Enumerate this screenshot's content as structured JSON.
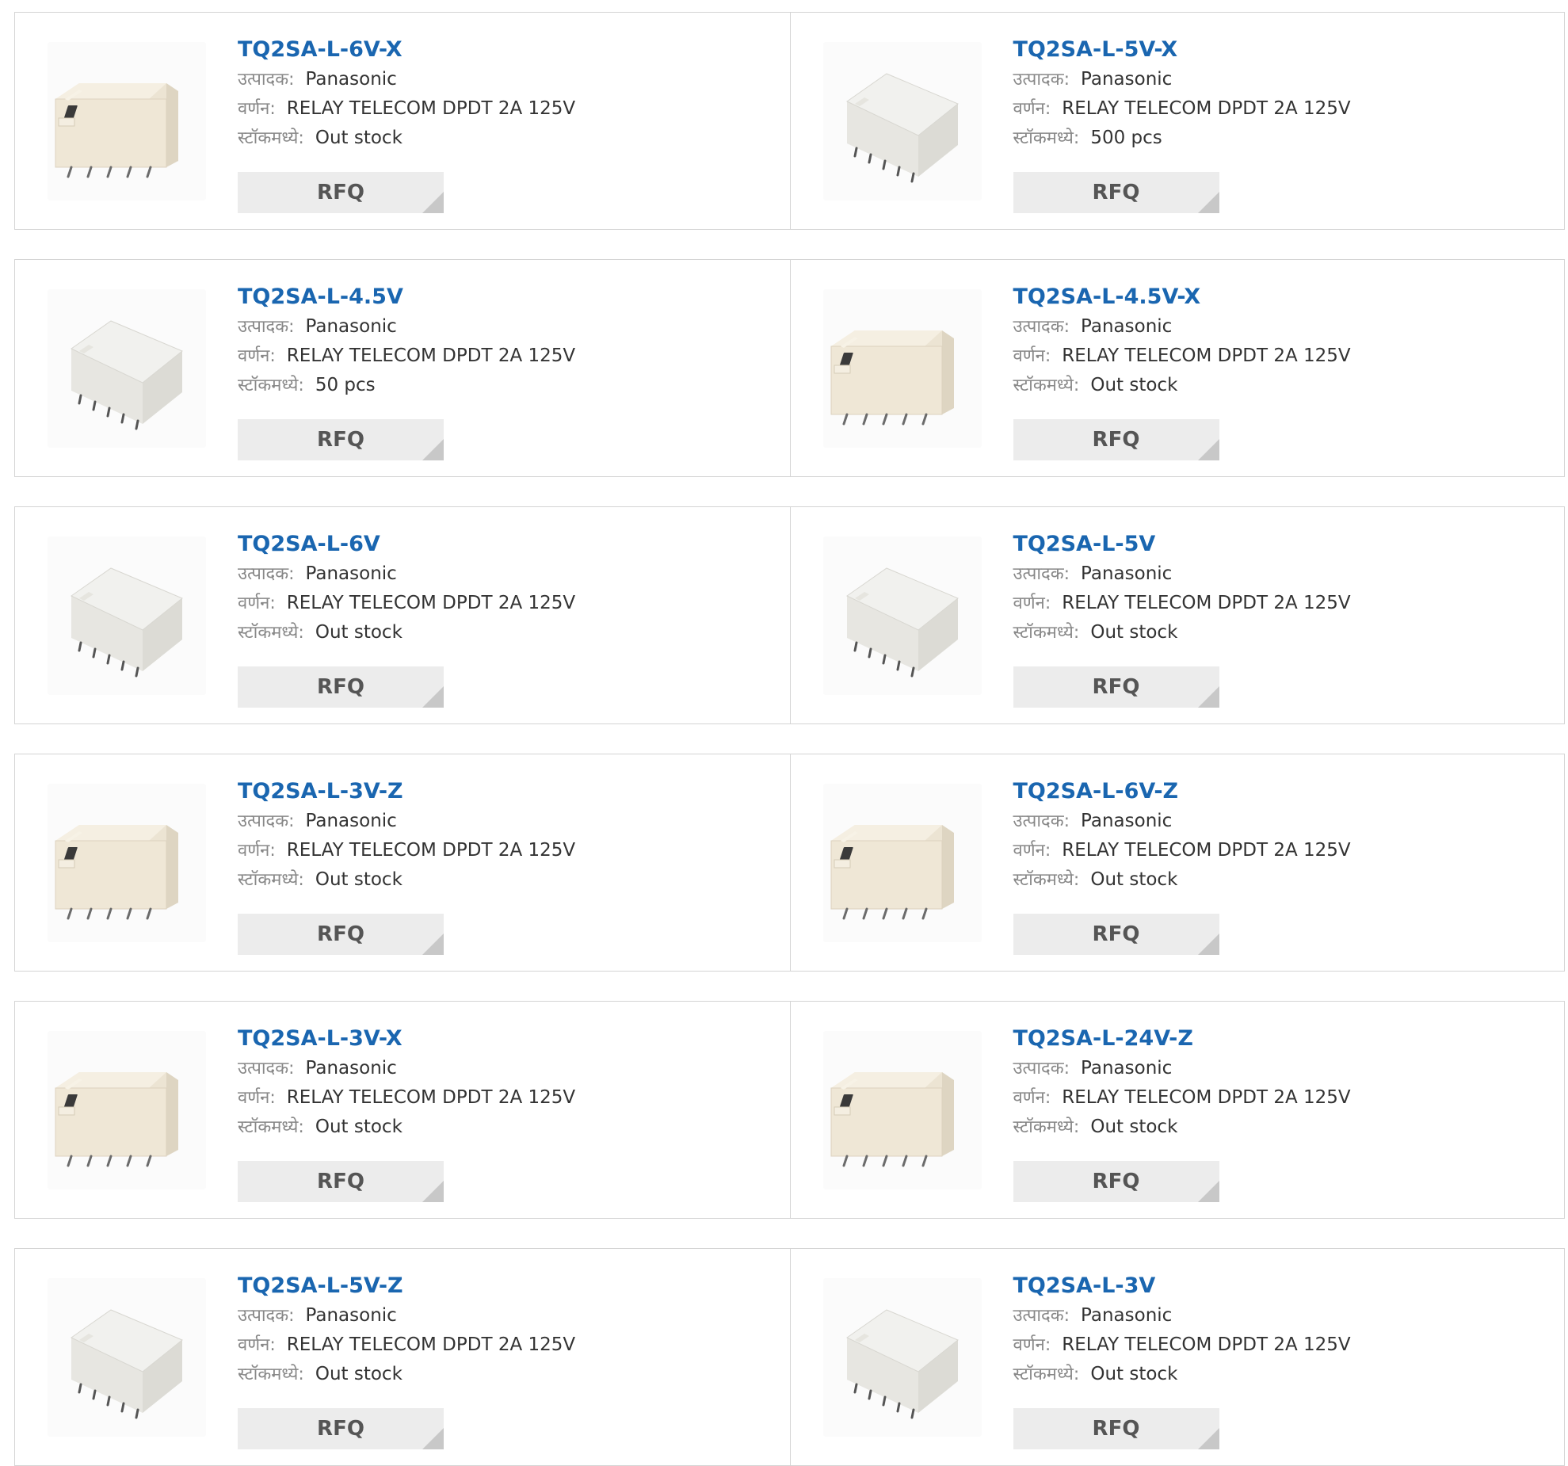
{
  "labels": {
    "manufacturer": "उत्पादक:",
    "description": "वर्णन:",
    "stock": "स्टॉकमध्ये:",
    "rfq_button": "RFQ"
  },
  "colors": {
    "part_link": "#1a66b0",
    "label_gray": "#888888",
    "value_text": "#333333",
    "button_bg": "#ececec",
    "border": "#d4d4d4"
  },
  "products": [
    {
      "part": "TQ2SA-L-6V-X",
      "manufacturer": "Panasonic",
      "description": "RELAY TELECOM DPDT 2A 125V",
      "stock": "Out stock",
      "image": "relay-beige-front"
    },
    {
      "part": "TQ2SA-L-5V-X",
      "manufacturer": "Panasonic",
      "description": "RELAY TELECOM DPDT 2A 125V",
      "stock": "500 pcs",
      "image": "relay-gray-angled"
    },
    {
      "part": "TQ2SA-L-4.5V",
      "manufacturer": "Panasonic",
      "description": "RELAY TELECOM DPDT 2A 125V",
      "stock": "50 pcs",
      "image": "relay-gray-angled"
    },
    {
      "part": "TQ2SA-L-4.5V-X",
      "manufacturer": "Panasonic",
      "description": "RELAY TELECOM DPDT 2A 125V",
      "stock": "Out stock",
      "image": "relay-beige-front"
    },
    {
      "part": "TQ2SA-L-6V",
      "manufacturer": "Panasonic",
      "description": "RELAY TELECOM DPDT 2A 125V",
      "stock": "Out stock",
      "image": "relay-gray-angled"
    },
    {
      "part": "TQ2SA-L-5V",
      "manufacturer": "Panasonic",
      "description": "RELAY TELECOM DPDT 2A 125V",
      "stock": "Out stock",
      "image": "relay-gray-angled"
    },
    {
      "part": "TQ2SA-L-3V-Z",
      "manufacturer": "Panasonic",
      "description": "RELAY TELECOM DPDT 2A 125V",
      "stock": "Out stock",
      "image": "relay-beige-front"
    },
    {
      "part": "TQ2SA-L-6V-Z",
      "manufacturer": "Panasonic",
      "description": "RELAY TELECOM DPDT 2A 125V",
      "stock": "Out stock",
      "image": "relay-beige-front"
    },
    {
      "part": "TQ2SA-L-3V-X",
      "manufacturer": "Panasonic",
      "description": "RELAY TELECOM DPDT 2A 125V",
      "stock": "Out stock",
      "image": "relay-beige-front"
    },
    {
      "part": "TQ2SA-L-24V-Z",
      "manufacturer": "Panasonic",
      "description": "RELAY TELECOM DPDT 2A 125V",
      "stock": "Out stock",
      "image": "relay-beige-front"
    },
    {
      "part": "TQ2SA-L-5V-Z",
      "manufacturer": "Panasonic",
      "description": "RELAY TELECOM DPDT 2A 125V",
      "stock": "Out stock",
      "image": "relay-gray-angled"
    },
    {
      "part": "TQ2SA-L-3V",
      "manufacturer": "Panasonic",
      "description": "RELAY TELECOM DPDT 2A 125V",
      "stock": "Out stock",
      "image": "relay-gray-angled"
    }
  ]
}
